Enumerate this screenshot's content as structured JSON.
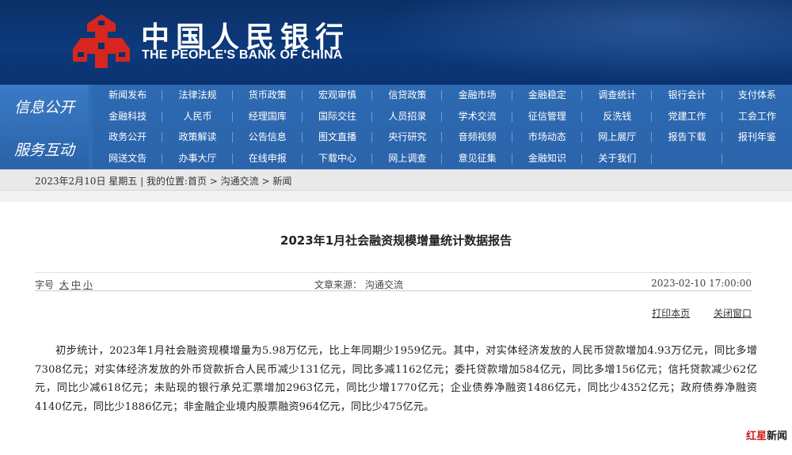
{
  "header": {
    "name_cn": "中国人民银行",
    "name_en": "THE PEOPLE'S BANK OF CHINA"
  },
  "nav": {
    "sections": [
      "信息公开",
      "服务互动"
    ],
    "rows": [
      [
        "新闻发布",
        "法律法规",
        "货币政策",
        "宏观审慎",
        "信贷政策",
        "金融市场",
        "金融稳定",
        "调查统计",
        "银行会计",
        "支付体系"
      ],
      [
        "金融科技",
        "人民币",
        "经理国库",
        "国际交往",
        "人员招录",
        "学术交流",
        "征信管理",
        "反洗钱",
        "党建工作",
        "工会工作"
      ],
      [
        "政务公开",
        "政策解读",
        "公告信息",
        "图文直播",
        "央行研究",
        "音频视频",
        "市场动态",
        "网上展厅",
        "报告下载",
        "报刊年鉴"
      ],
      [
        "网送文告",
        "办事大厅",
        "在线申报",
        "下载中心",
        "网上调查",
        "意见征集",
        "金融知识",
        "关于我们",
        "",
        ""
      ]
    ]
  },
  "breadcrumb": "2023年2月10日 星期五 | 我的位置:首页 > 沟通交流 > 新闻",
  "article": {
    "title": "2023年1月社会融资规模增量统计数据报告",
    "font_size_label": "字号",
    "font_sizes": [
      "大",
      "中",
      "小"
    ],
    "source": "文章来源：  沟通交流",
    "date": "2023-02-10 17:00:00",
    "print_label": "打印本页",
    "close_label": "关闭窗口",
    "body": "初步统计，2023年1月社会融资规模增量为5.98万亿元，比上年同期少1959亿元。其中，对实体经济发放的人民币贷款增加4.93万亿元，同比多增7308亿元；对实体经济发放的外币贷款折合人民币减少131亿元，同比多减1162亿元；委托贷款增加584亿元，同比多增156亿元；信托贷款减少62亿元，同比少减618亿元；未贴现的银行承兑汇票增加2963亿元，同比少增1770亿元；企业债券净融资1486亿元，同比少4352亿元；政府债券净融资4140亿元，同比少1886亿元；非金融企业境内股票融资964亿元，同比少475亿元。"
  },
  "watermark": {
    "red": "红星",
    "black": "新闻"
  },
  "colors": {
    "header_bg": "#0b2f66",
    "nav_bg": "#2f6db5",
    "emblem_red": "#d6261f"
  },
  "icons": {
    "emblem": "pboc-emblem-icon"
  }
}
